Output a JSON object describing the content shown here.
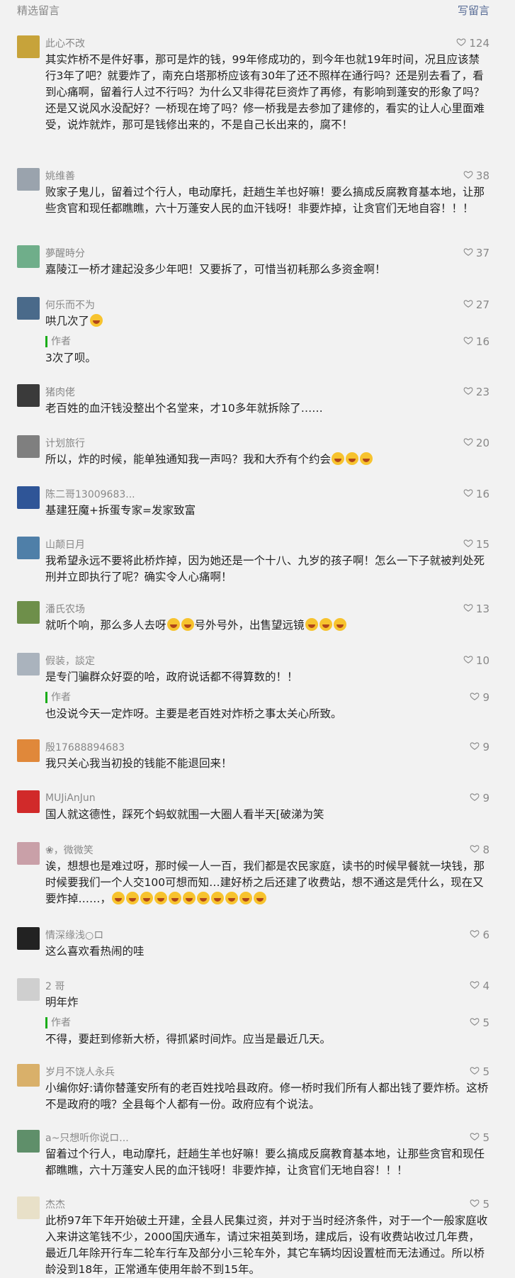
{
  "header": {
    "title": "精选留言",
    "write_label": "写留言"
  },
  "comments": [
    {
      "nick": "此心不改",
      "likes": "124",
      "avatar_color": "#c7a33a",
      "content": "其实炸桥不是件好事，那可是炸的钱，99年修成功的，到今年也就19年时间，况且应该禁行3年了吧？就要炸了，南充白塔那桥应该有30年了还不照样在通行吗？还是别去看了，看到心痛啊，留着行人过不行吗？为什么又非得花巨资炸了再修，有影响到蓬安的形象了吗？还是又说风水没配好？一桥现在垮了吗？修一桥我是去参加了建修的，看实的让人心里面难受，说炸就炸，那可是钱修出来的，不是自己长出来的，腐不！"
    },
    {
      "nick": "姚维善",
      "likes": "38",
      "avatar_color": "#9aa3ad",
      "content": "败家子鬼儿，留着过个行人，电动摩托，赶趟生羊也好嘛！要么搞成反腐教育基本地，让那些贪官和现任都瞧瞧，六十万蓬安人民的血汗钱呀！非要炸掉，让贪官们无地自容！！！"
    },
    {
      "nick": "夢醒時分",
      "likes": "37",
      "avatar_color": "#6fae8a",
      "content": "嘉陵江一桥才建起没多少年吧！又要拆了，可惜当初耗那么多资金啊！"
    },
    {
      "nick": "何乐而不为",
      "likes": "27",
      "avatar_color": "#4a6a8a",
      "content": "哄几次了",
      "emojis": 1,
      "reply": {
        "label": "作者",
        "likes": "16",
        "content": "3次了呗。"
      }
    },
    {
      "nick": "猪肉佬",
      "likes": "23",
      "avatar_color": "#3a3a3a",
      "content": "老百姓的血汗钱没整出个名堂来，才10多年就拆除了……"
    },
    {
      "nick": "计划旅行",
      "likes": "20",
      "avatar_color": "#7f7f7f",
      "content": "所以，炸的时候，能单独通知我一声吗？我和大乔有个约会",
      "emojis": 3
    },
    {
      "nick": "陈二哥13009683...",
      "likes": "16",
      "avatar_color": "#2f5597",
      "content": "基建狂魔+拆蛋专家=发家致富"
    },
    {
      "nick": "山颠日月",
      "likes": "15",
      "avatar_color": "#4f7fa8",
      "content": "我希望永远不要将此桥炸掉，因为她还是一个十八、九岁的孩子啊！怎么一下子就被判处死刑并立即执行了呢？确实令人心痛啊！"
    },
    {
      "nick": "潘氏农场",
      "likes": "13",
      "avatar_color": "#6e8f4a",
      "content": "就听个响，那么多人去呀",
      "content_tail": "号外号外，出售望远镜"
    },
    {
      "nick": "假装，談定",
      "likes": "10",
      "avatar_color": "#aab3bd",
      "content": "是专门骗群众好耍的哈，政府说话都不得算数的！！",
      "reply": {
        "label": "作者",
        "likes": "9",
        "content": "也没说今天一定炸呀。主要是老百姓对炸桥之事太关心所致。"
      }
    },
    {
      "nick": "殷17688894683",
      "likes": "9",
      "avatar_color": "#e0883a",
      "content": "我只关心我当初投的钱能不能退回来！"
    },
    {
      "nick": "MUJiAnJun",
      "likes": "9",
      "avatar_color": "#d12a2a",
      "content": "国人就这德性，踩死个蚂蚁就围一大圈人看半天[破涕为笑"
    },
    {
      "nick": "❀，微微笑",
      "likes": "8",
      "avatar_color": "#c9a0a8",
      "content": "诶，想想也是难过呀，那时候一人一百，我们都是农民家庭，读书的时候早餐就一块钱，那时候要我们一个人交100可想而知…建好桥之后还建了收费站，想不通这是凭什么，现在又要炸掉……，",
      "emojis": 11
    },
    {
      "nick": "情深缘浅○ロ",
      "likes": "6",
      "avatar_color": "#222222",
      "content": "这么喜欢看热闹的哇"
    },
    {
      "nick": "2 哥",
      "likes": "4",
      "avatar_color": "#cfcfcf",
      "content": "明年炸",
      "reply": {
        "label": "作者",
        "likes": "5",
        "content": "不得，要赶到修新大桥，得抓紧时间炸。应当是最近几天。"
      }
    },
    {
      "nick": "岁月不饶人永兵",
      "likes": "5",
      "avatar_color": "#d9b06a",
      "content": "小编你好:请你替蓬安所有的老百姓找哈县政府。修一桥时我们所有人都出钱了要炸桥。这桥不是政府的哦？全县每个人都有一份。政府应有个说法。"
    },
    {
      "nick": "a~只想听你说ロ...",
      "likes": "5",
      "avatar_color": "#5f8f6a",
      "content": "留着过个行人，电动摩托，赶趟生羊也好嘛！要么搞成反腐教育基本地，让那些贪官和现任都瞧瞧，六十万蓬安人民的血汗钱呀！非要炸掉，让贪官们无地自容！！！"
    },
    {
      "nick": "杰杰",
      "likes": "5",
      "avatar_color": "#e8e0c8",
      "content": "此桥97年下年开始破土开建，全县人民集过资，并对于当时经济条件，对于一个一般家庭收入来讲这笔钱不少，2000国庆通车，请过宋祖英到场，建成后，设有收费站收过几年费，最近几年除开行车二轮车行车及部分小三轮车外，其它车辆均因设置桩而无法通过。所以桥龄没到18年，正常通车使用年龄不到15年。"
    }
  ]
}
